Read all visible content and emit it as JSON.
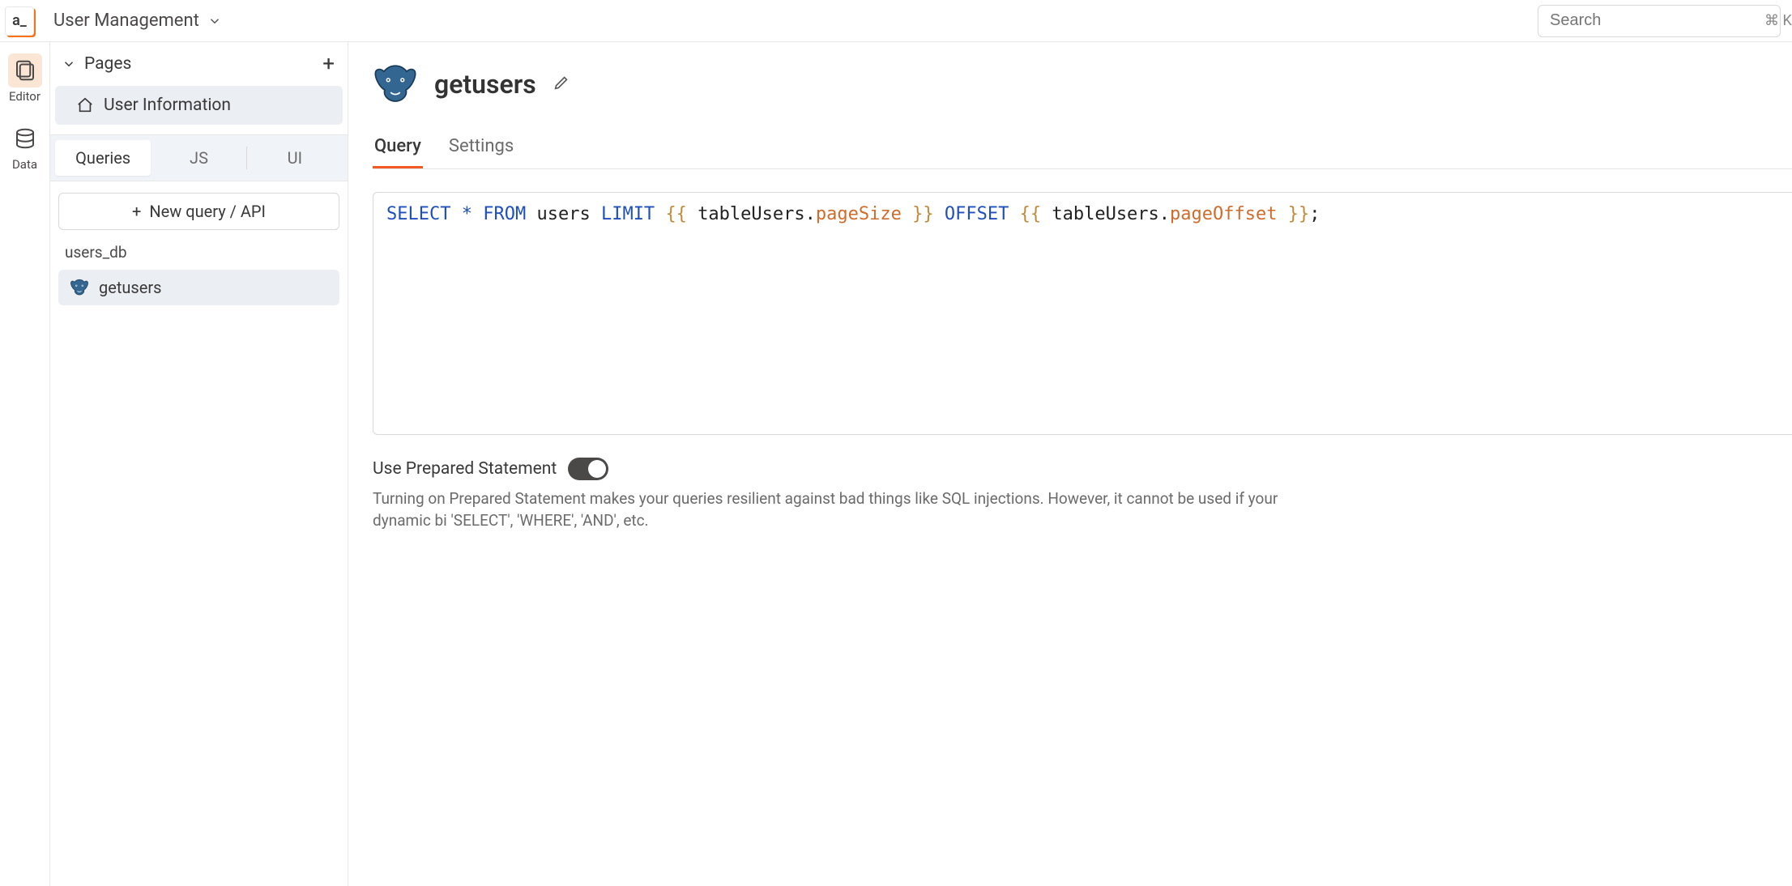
{
  "header": {
    "logo_text": "a_",
    "app_title": "User Management",
    "search_placeholder": "Search",
    "search_shortcut": "⌘ K"
  },
  "leftrail": {
    "editor": "Editor",
    "data": "Data"
  },
  "sidebar": {
    "pages_label": "Pages",
    "pages": [
      {
        "label": "User Information"
      }
    ],
    "mini_tabs": {
      "queries": "Queries",
      "js": "JS",
      "ui": "UI"
    },
    "new_query_label": "New query / API",
    "datasource_label": "users_db",
    "queries": [
      {
        "label": "getusers"
      }
    ]
  },
  "main": {
    "query_name": "getusers",
    "tabs": {
      "query": "Query",
      "settings": "Settings"
    },
    "sql": {
      "kw_select": "SELECT",
      "star": "*",
      "kw_from": "FROM",
      "table": "users",
      "kw_limit": "LIMIT",
      "open1": "{{",
      "obj1": "tableUsers",
      "dot1": ".",
      "prop1": "pageSize",
      "close1": "}}",
      "kw_offset": "OFFSET",
      "open2": "{{",
      "obj2": "tableUsers",
      "dot2": ".",
      "prop2": "pageOffset",
      "close2": "}}",
      "semicolon": ";"
    },
    "prepared_label": "Use Prepared Statement",
    "prepared_help": "Turning on Prepared Statement makes your queries resilient against bad things like SQL injections. However, it cannot be used if your dynamic bi 'SELECT', 'WHERE', 'AND', etc."
  }
}
